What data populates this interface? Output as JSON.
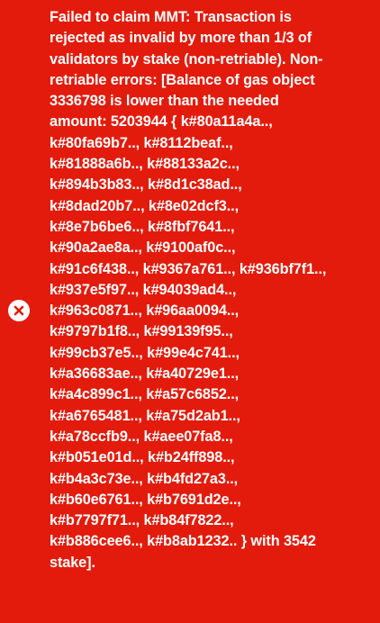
{
  "toast": {
    "type": "error",
    "icon": "close-circle-icon",
    "background_color": "#e31b0c",
    "text_color": "#ffffff",
    "message": "Failed to claim MMT: Transaction is\nrejected as invalid by more than 1/3 of\nvalidators by stake (non-retriable). Non-\nretriable errors: [Balance of gas object\n3336798 is lower than the needed\namount: 5203944 { k#80a11a4a..,\nk#80fa69b7.., k#8112beaf..,\nk#81888a6b.., k#88133a2c..,\nk#894b3b83.., k#8d1c38ad..,\nk#8dad20b7.., k#8e02dcf3..,\nk#8e7b6be6.., k#8fbf7641..,\nk#90a2ae8a.., k#9100af0c..,\nk#91c6f438.., k#9367a761.., k#936bf7f1..,\nk#937e5f97.., k#94039ad4..,\nk#963c0871.., k#96aa0094..,\nk#9797b1f8.., k#99139f95..,\nk#99cb37e5.., k#99e4c741..,\nk#a36683ae.., k#a40729e1..,\nk#a4c899c1.., k#a57c6852..,\nk#a6765481.., k#a75d2ab1..,\nk#a78ccfb9.., k#aee07fa8..,\nk#b051e01d.., k#b24ff898..,\nk#b4a3c73e.., k#b4fd27a3..,\nk#b60e6761.., k#b7691d2e..,\nk#b7797f71.., k#b84f7822..,\nk#b886cee6.., k#b8ab1232.. } with 3542\nstake]."
  }
}
